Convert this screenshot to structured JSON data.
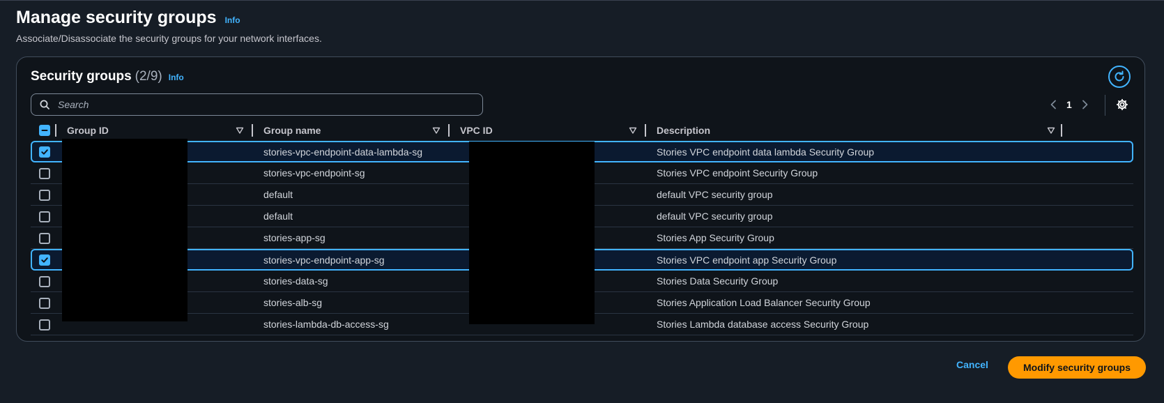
{
  "page": {
    "title": "Manage security groups",
    "info_label": "Info",
    "description": "Associate/Disassociate the security groups for your network interfaces."
  },
  "panel": {
    "title": "Security groups",
    "count": "(2/9)",
    "info_label": "Info",
    "search": {
      "placeholder": "Search",
      "value": ""
    },
    "pagination": {
      "current_page": "1"
    },
    "columns": [
      {
        "label": "Group ID"
      },
      {
        "label": "Group name"
      },
      {
        "label": "VPC ID"
      },
      {
        "label": "Description"
      }
    ],
    "rows": [
      {
        "selected": true,
        "group_name": "stories-vpc-endpoint-data-lambda-sg",
        "description": "Stories VPC endpoint data lambda Security Group"
      },
      {
        "selected": false,
        "group_name": "stories-vpc-endpoint-sg",
        "description": "Stories VPC endpoint Security Group"
      },
      {
        "selected": false,
        "group_name": "default",
        "description": "default VPC security group"
      },
      {
        "selected": false,
        "group_name": "default",
        "description": "default VPC security group"
      },
      {
        "selected": false,
        "group_name": "stories-app-sg",
        "description": "Stories App Security Group"
      },
      {
        "selected": true,
        "group_name": "stories-vpc-endpoint-app-sg",
        "description": "Stories VPC endpoint app Security Group"
      },
      {
        "selected": false,
        "group_name": "stories-data-sg",
        "description": "Stories Data Security Group"
      },
      {
        "selected": false,
        "group_name": "stories-alb-sg",
        "description": "Stories Application Load Balancer Security Group"
      },
      {
        "selected": false,
        "group_name": "stories-lambda-db-access-sg",
        "description": "Stories Lambda database access Security Group"
      }
    ]
  },
  "footer": {
    "cancel_label": "Cancel",
    "submit_label": "Modify security groups"
  },
  "colors": {
    "background": "#161d26",
    "panel_background": "#0f141a",
    "accent": "#42b4ff",
    "primary_button": "#ff9900",
    "redaction": "#000000"
  },
  "icons": {
    "search": "search-icon",
    "refresh": "refresh-icon",
    "settings": "gear-icon",
    "prev": "chevron-left-icon",
    "next": "chevron-right-icon",
    "filter": "filter-triangle-icon"
  }
}
